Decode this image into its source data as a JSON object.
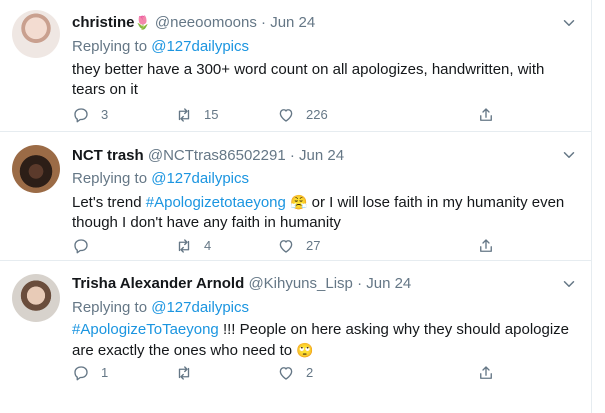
{
  "tweets": [
    {
      "name": "christine",
      "name_emoji": "🌷",
      "handle": "@neeoomoons",
      "separator": "·",
      "date": "Jun 24",
      "replying_prefix": "Replying to",
      "replying_to": "@127dailypics",
      "text": "they better have a 300+ word count on all apologizes, handwritten, with tears on it",
      "replies": "3",
      "retweets": "15",
      "likes": "226",
      "avatar_icon": "avatar-photo"
    },
    {
      "name": "NCT trash",
      "handle": "@NCTtras86502291",
      "separator": "·",
      "date": "Jun 24",
      "replying_prefix": "Replying to",
      "replying_to": "@127dailypics",
      "text_before": "Let's trend",
      "hashtag": "#Apologizetotaeyong",
      "emoji": "😤",
      "text_after": "or I will lose faith in my humanity even though I don't have any faith in humanity",
      "replies": "",
      "retweets": "4",
      "likes": "27",
      "avatar_icon": "avatar-photo"
    },
    {
      "name": "Trisha Alexander Arnold",
      "handle": "@Kihyuns_Lisp",
      "separator": "·",
      "date": "Jun 24",
      "replying_prefix": "Replying to",
      "replying_to": "@127dailypics",
      "hashtag": "#ApologizeToTaeyong",
      "text_after": "!!! People on here asking why they should apologize are exactly the ones who need to",
      "emoji": "🙄",
      "replies": "1",
      "retweets": "",
      "likes": "2",
      "avatar_icon": "avatar-photo"
    }
  ],
  "icons": {
    "reply": "reply-icon",
    "retweet": "retweet-icon",
    "like": "like-icon",
    "share": "share-icon",
    "more": "chevron-down-icon"
  },
  "colors": {
    "text": "#14171a",
    "secondary": "#657786",
    "link": "#1b95e0",
    "divider": "#e6ecf0"
  }
}
